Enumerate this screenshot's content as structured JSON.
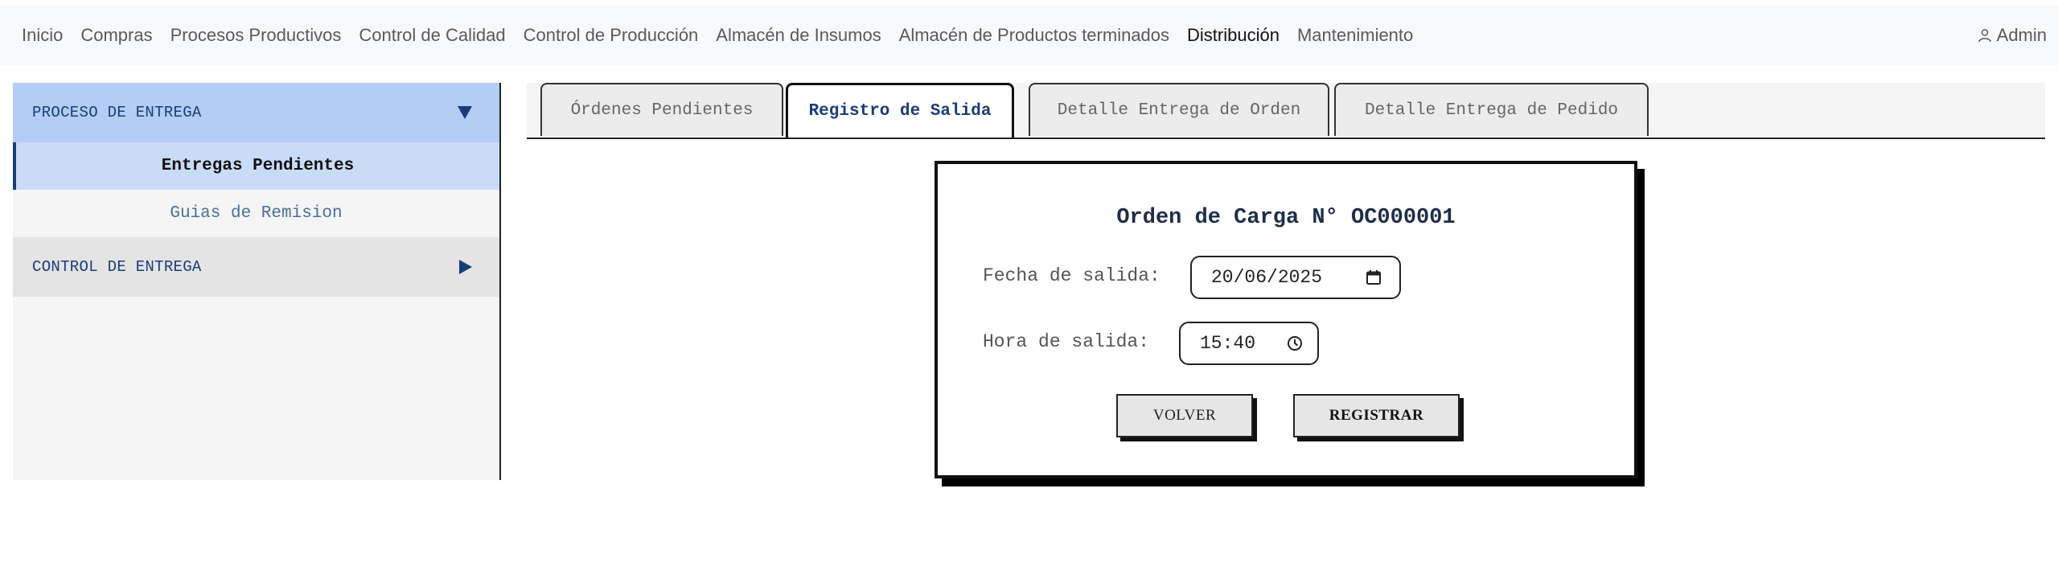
{
  "navbar": {
    "links": [
      {
        "label": "Inicio"
      },
      {
        "label": "Compras"
      },
      {
        "label": "Procesos Productivos"
      },
      {
        "label": "Control de Calidad"
      },
      {
        "label": "Control de Producción"
      },
      {
        "label": "Almacén de Insumos"
      },
      {
        "label": "Almacén de Productos terminados"
      },
      {
        "label": "Distribución"
      },
      {
        "label": "Mantenimiento"
      }
    ],
    "active": "Distribución",
    "user_icon": "user-icon",
    "user_label": "Admin"
  },
  "sidebar": {
    "sections": [
      {
        "label": "PROCESO DE ENTREGA",
        "state": "expanded",
        "icon": "triangle-down-icon",
        "items": [
          {
            "label": "Entregas Pendientes",
            "active": true
          },
          {
            "label": "Guias de Remision",
            "active": false
          }
        ]
      },
      {
        "label": "CONTROL DE ENTREGA",
        "state": "collapsed",
        "icon": "triangle-right-icon"
      }
    ]
  },
  "tabs": [
    {
      "label": "Órdenes Pendientes"
    },
    {
      "label": "Registro de Salida"
    },
    {
      "label": "Detalle Entrega de Orden"
    },
    {
      "label": "Detalle Entrega de Pedido"
    }
  ],
  "active_tab": "Registro de Salida",
  "form": {
    "title": "Orden de Carga N° OC000001",
    "fecha_label": "Fecha de salida:",
    "fecha_value": "20/06/2025",
    "fecha_icon": "calendar-icon",
    "hora_label": "Hora de salida:",
    "hora_value": "15:40",
    "hora_icon": "clock-icon",
    "back_label": "VOLVER",
    "submit_label": "REGISTRAR"
  },
  "colors": {
    "accent_dark_blue": "#1a3c7a",
    "sidebar_header_open": "#b3cdf5",
    "sidebar_item_active": "#c9dcf7"
  }
}
